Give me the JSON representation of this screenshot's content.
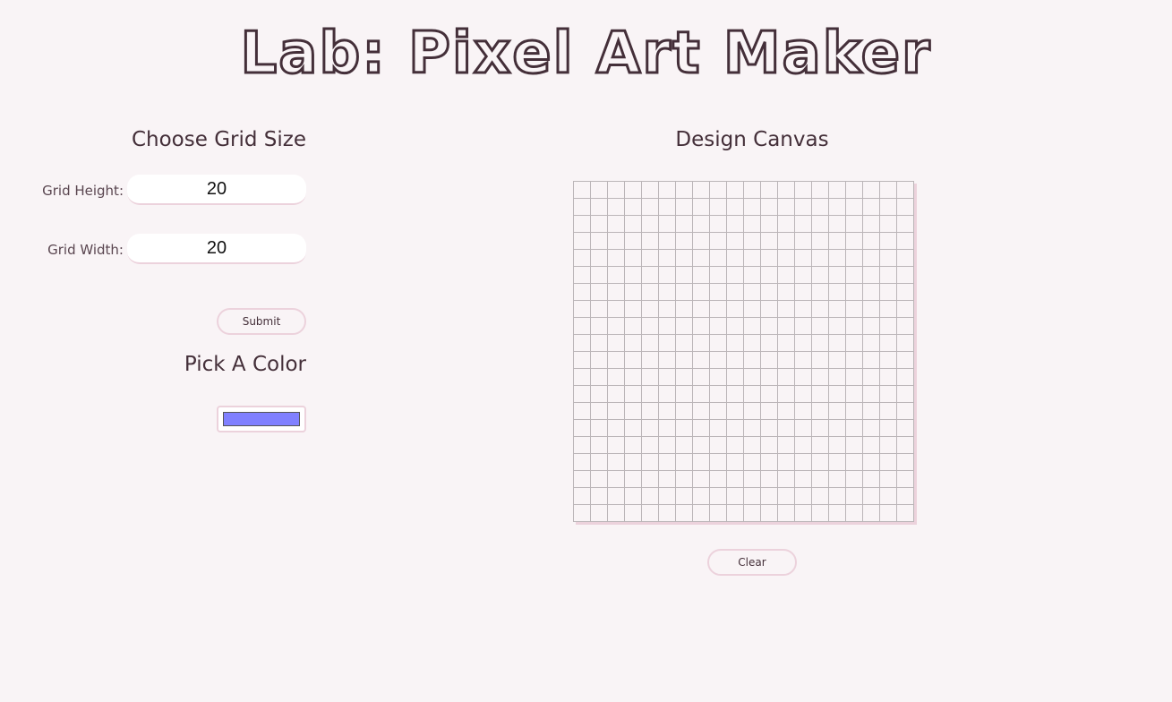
{
  "page": {
    "title": "Lab: Pixel Art Maker"
  },
  "grid_size": {
    "heading": "Choose Grid Size",
    "height_label": "Grid Height:",
    "height_value": "20",
    "width_label": "Grid Width:",
    "width_value": "20",
    "submit_label": "Submit"
  },
  "color": {
    "heading": "Pick A Color",
    "selected": "#8080ff"
  },
  "canvas": {
    "heading": "Design Canvas",
    "rows": 20,
    "columns": 20,
    "clear_label": "Clear"
  },
  "colors": {
    "background": "#f9f4f6",
    "text": "#442f39",
    "accent_border": "#ecd2dc",
    "grid_line": "#bbb5b8"
  }
}
